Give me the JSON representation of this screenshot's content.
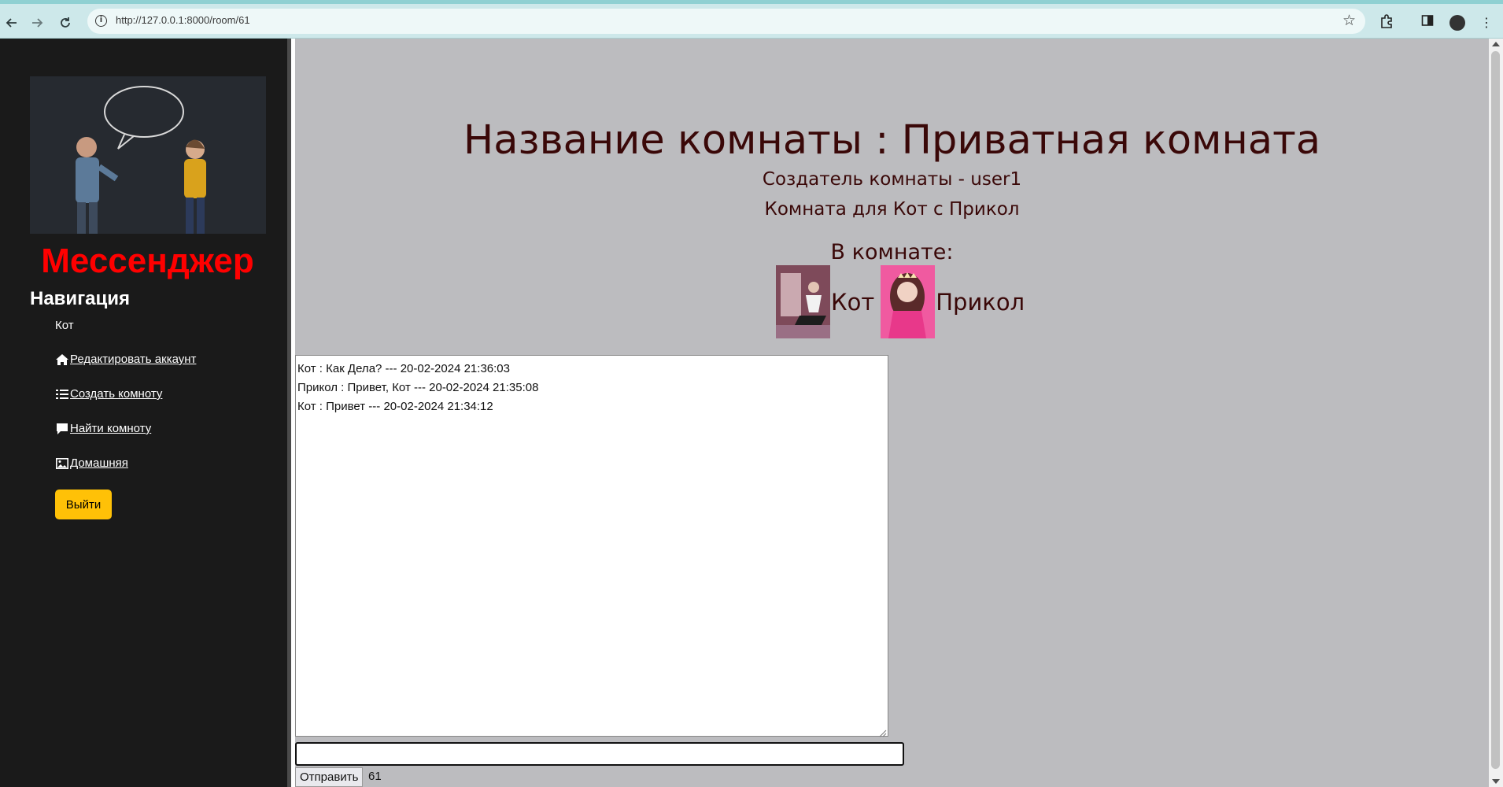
{
  "browser": {
    "url": "http://127.0.0.1:8000/room/61",
    "back_icon": "arrow-left-icon",
    "forward_icon": "arrow-right-icon",
    "reload_icon": "reload-icon",
    "info_icon": "info-icon",
    "bookmark_icon": "star-icon",
    "extensions_icon": "puzzle-icon",
    "sidepanel_icon": "side-panel-icon",
    "profile_icon": "profile-avatar-icon",
    "menu_icon": "kebab-menu-icon"
  },
  "sidebar": {
    "app_title": "Мессенджер",
    "nav_heading": "Навигация",
    "current_user": "Кот",
    "links": [
      {
        "label": "Редактировать аккаунт",
        "icon": "home-icon"
      },
      {
        "label": "Создать комноту",
        "icon": "list-icon"
      },
      {
        "label": "Найти комноту",
        "icon": "chat-bubble-icon"
      },
      {
        "label": "Домашняя",
        "icon": "image-icon"
      }
    ],
    "logout_label": "Выйти",
    "colors": {
      "title": "#ff0000",
      "logout": "#ffc107",
      "background": "#1a1a1a"
    }
  },
  "room": {
    "title": "Название комнаты : Приватная комната",
    "creator": "Создатель комнаты - user1",
    "description": "Комната для Кот с Прикол",
    "members_heading": "В комнате:",
    "members": [
      {
        "name": "Кот"
      },
      {
        "name": "Прикол"
      }
    ],
    "messages": [
      "Кот : Как Дела? --- 20-02-2024 21:36:03",
      "Прикол : Привет, Кот --- 20-02-2024 21:35:08",
      "Кот : Привет --- 20-02-2024 21:34:12"
    ],
    "message_input_value": "",
    "send_label": "Отправить",
    "room_id": "61",
    "colors": {
      "heading": "#3a0808",
      "background": "#bcbcbf"
    }
  }
}
